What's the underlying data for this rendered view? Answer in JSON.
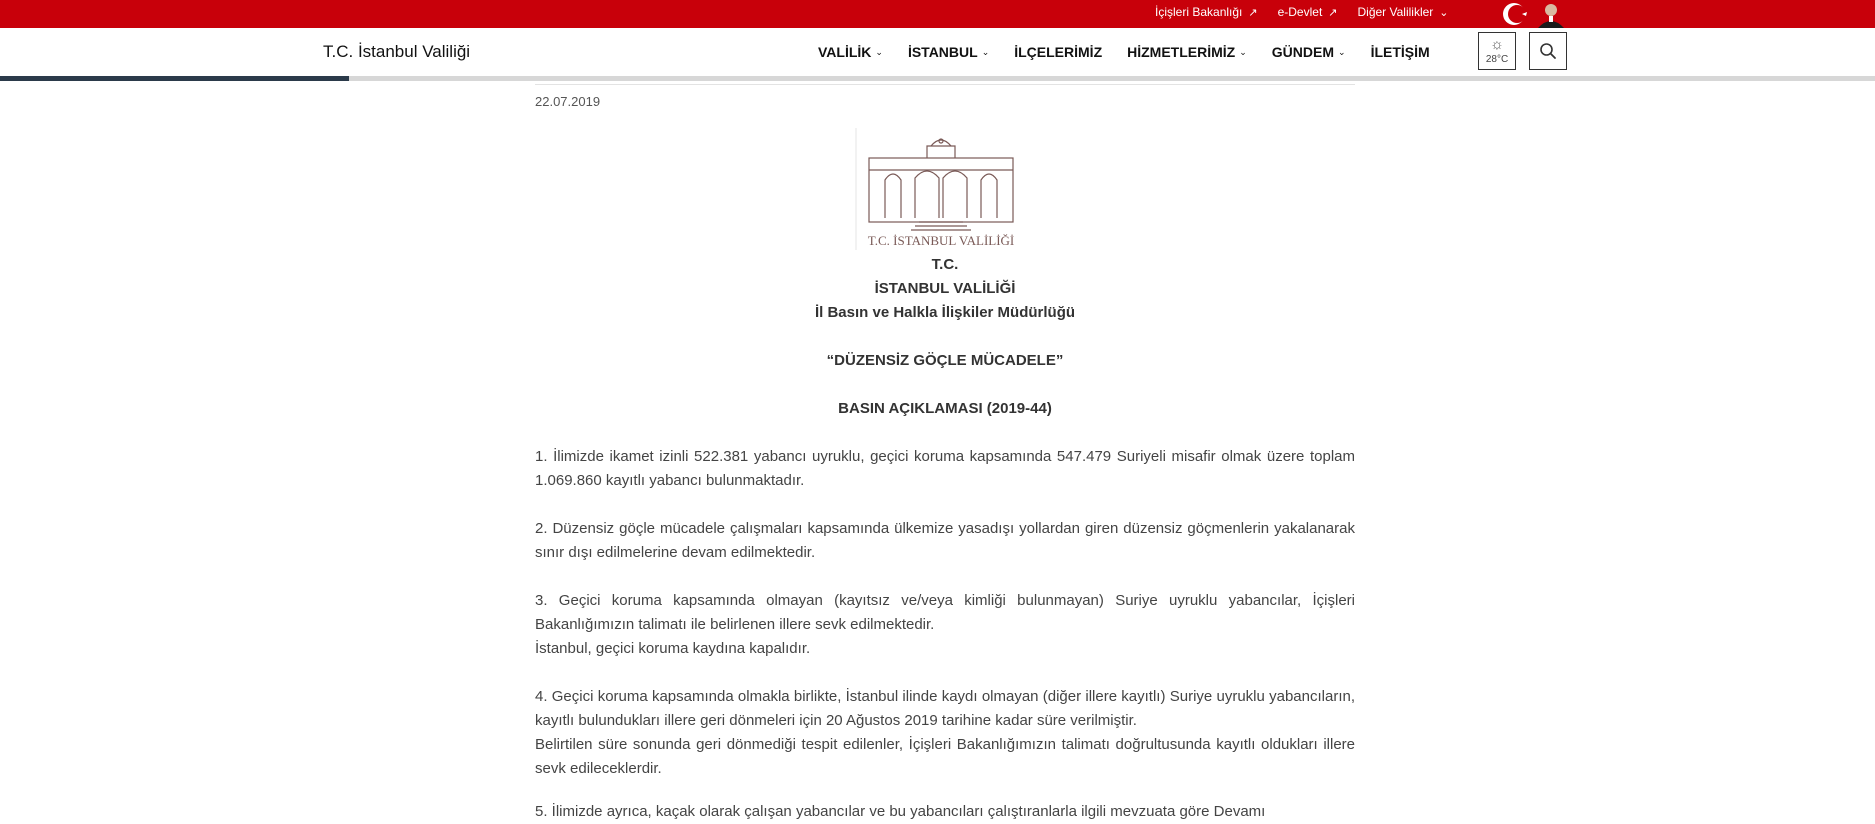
{
  "topbar": {
    "links": [
      {
        "label": "İçişleri Bakanlığı",
        "icon": "arrow-up-right-icon"
      },
      {
        "label": "e-Devlet",
        "icon": "arrow-up-right-icon"
      },
      {
        "label": "Diğer Valilikler",
        "icon": "chevron-down-icon"
      }
    ],
    "color": "#c8000a"
  },
  "navbar": {
    "brand": "T.C. İstanbul Valiliği",
    "menu": [
      {
        "label": "VALİLİK",
        "dropdown": true
      },
      {
        "label": "İSTANBUL",
        "dropdown": true
      },
      {
        "label": "İLÇELERİMİZ",
        "dropdown": false
      },
      {
        "label": "HİZMETLERİMİZ",
        "dropdown": true
      },
      {
        "label": "GÜNDEM",
        "dropdown": true
      },
      {
        "label": "İLETİŞİM",
        "dropdown": false
      }
    ],
    "weather": {
      "temp": "28°C",
      "icon": "sun-icon"
    }
  },
  "reading_progress": 0.186,
  "article": {
    "date": "22.07.2019",
    "logo_text": "T.C. İSTANBUL VALİLİĞİ",
    "header_lines": [
      "T.C.",
      "İSTANBUL VALİLİĞİ",
      "İl Basın ve Halkla İlişkiler Müdürlüğü",
      "",
      "“DÜZENSİZ GÖÇLE MÜCADELE”",
      "",
      "BASIN AÇIKLAMASI (2019-44)"
    ],
    "paragraphs": [
      [
        "1. İlimizde ikamet izinli 522.381 yabancı uyruklu, geçici koruma kapsamında 547.479 Suriyeli misafir olmak üzere toplam 1.069.860 kayıtlı yabancı bulunmaktadır."
      ],
      [
        "2. Düzensiz göçle mücadele çalışmaları kapsamında ülkemize yasadışı yollardan giren düzensiz göçmenlerin yakalanarak sınır dışı edilmelerine devam edilmektedir."
      ],
      [
        "3. Geçici koruma kapsamında olmayan (kayıtsız ve/veya kimliği bulunmayan) Suriye uyruklu yabancılar, İçişleri Bakanlığımızın talimatı ile belirlenen illere sevk edilmektedir.",
        "İstanbul, geçici koruma kaydına kapalıdır."
      ],
      [
        "4. Geçici koruma kapsamında olmakla birlikte, İstanbul ilinde kaydı olmayan (diğer illere kayıtlı) Suriye uyruklu yabancıların, kayıtlı bulundukları illere geri dönmeleri için 20 Ağustos 2019 tarihine kadar süre verilmiştir.",
        "Belirtilen süre sonunda geri dönmediği tespit edilenler, İçişleri Bakanlığımızın talimatı doğrultusunda kayıtlı oldukları illere sevk edileceklerdir."
      ]
    ],
    "truncated_line": "5. İlimizde ayrıca, kaçak olarak çalışan yabancılar ve bu yabancıları çalıştıranlarla ilgili mevzuata göre Devamı"
  }
}
